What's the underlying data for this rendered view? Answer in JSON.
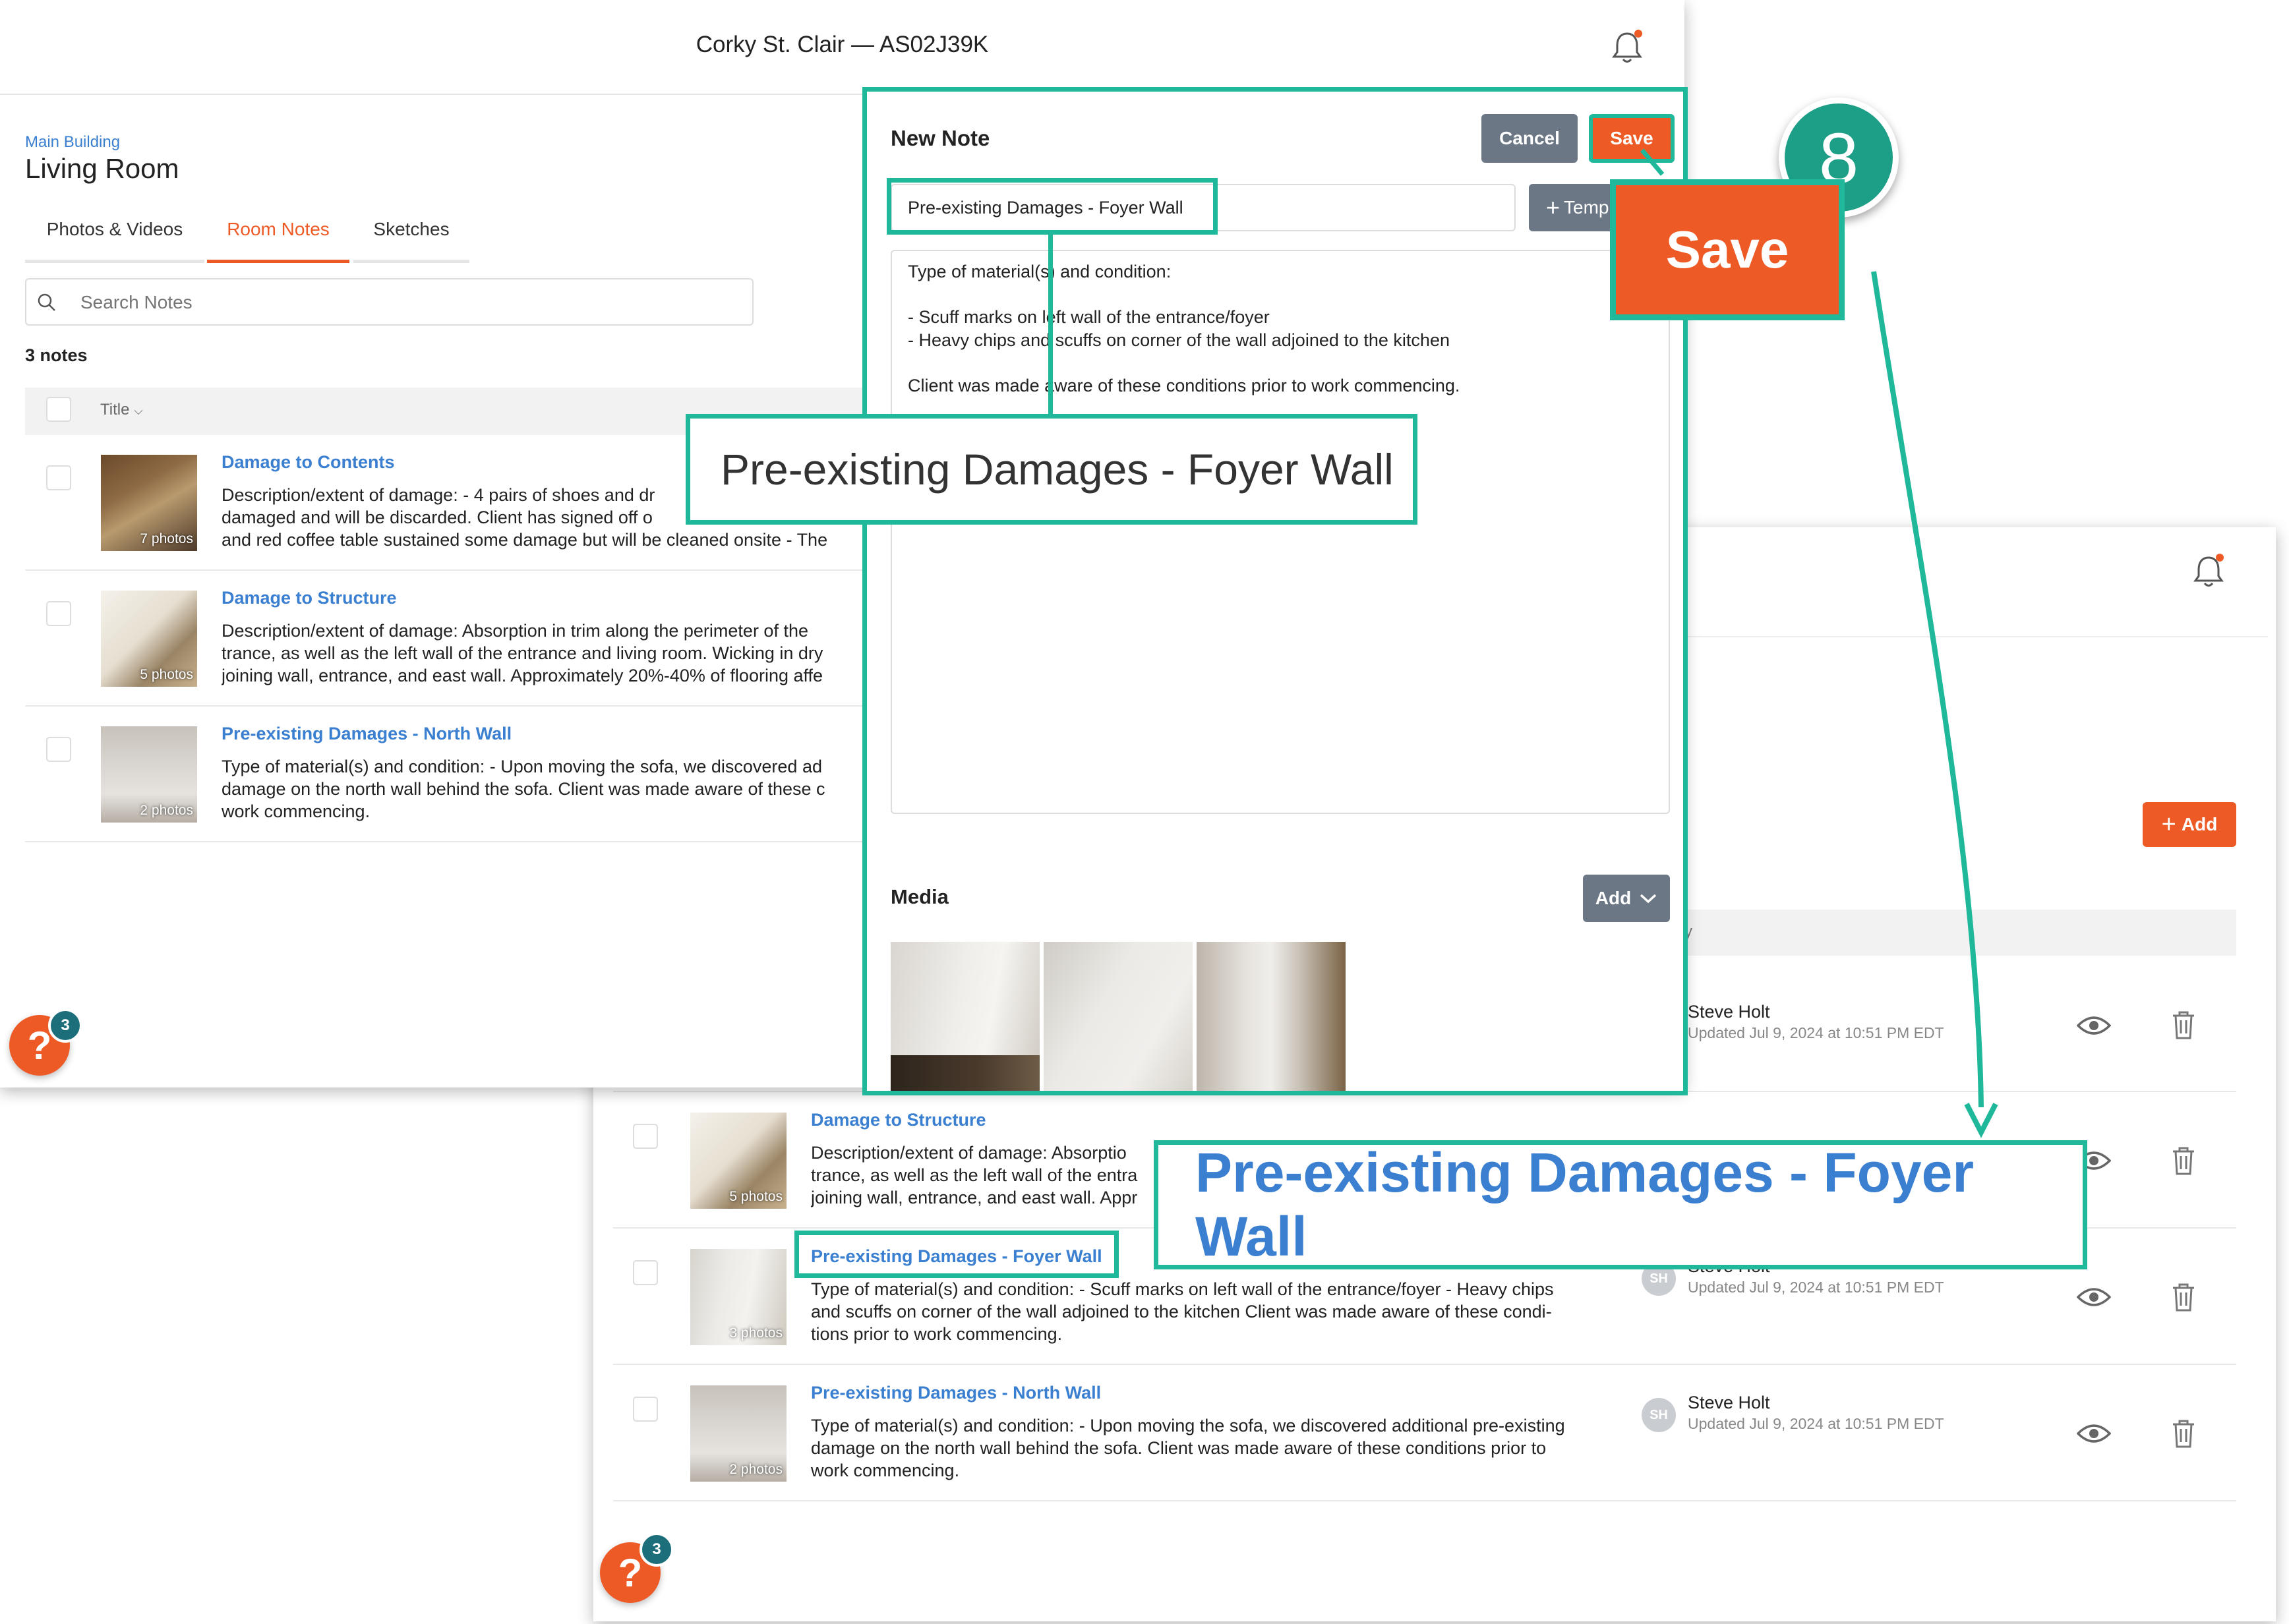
{
  "header": {
    "title": "Corky St. Clair — AS02J39K"
  },
  "room": {
    "breadcrumb": "Main Building",
    "title": "Living Room",
    "tabs": [
      {
        "label": "Photos & Videos"
      },
      {
        "label": "Room Notes"
      },
      {
        "label": "Sketches"
      }
    ],
    "search_placeholder": "Search Notes",
    "notes_count": "3 notes",
    "column_title": "Title",
    "column_by_fragment": "y"
  },
  "back_notes": [
    {
      "title": "Damage to Contents",
      "photos": "7 photos",
      "desc": "Description/extent of damage: - 4 pairs of shoes and dr\ndamaged and will be discarded. Client has signed off o\nand red coffee table sustained some damage but will be cleaned onsite - The"
    },
    {
      "title": "Damage to Structure",
      "photos": "5 photos",
      "desc": "Description/extent of damage: Absorption in trim along the perimeter of the\ntrance, as well as the left wall of the entrance and living room. Wicking in dry\njoining wall, entrance, and east wall. Approximately 20%-40% of flooring affe"
    },
    {
      "title": "Pre-existing Damages - North Wall",
      "photos": "2 photos",
      "desc": "Type of material(s) and condition: - Upon moving the sofa, we discovered ad\ndamage on the north wall behind the sofa. Client was made aware of these c\nwork commencing."
    }
  ],
  "result_notes": [
    {
      "title": "Damage to Structure",
      "photos": "5 photos",
      "desc": "Description/extent of damage: Absorptio\ntrance, as well as the left wall of the entra\njoining wall, entrance, and east wall. Appr",
      "user": "",
      "updated": ""
    },
    {
      "title": "Pre-existing Damages - Foyer Wall",
      "photos": "3 photos",
      "desc": "Type of material(s) and condition: - Scuff marks on left wall of the entrance/foyer - Heavy chips\nand scuffs on corner of the wall adjoined to the kitchen Client was made aware of these condi-\ntions prior to work commencing.",
      "initials": "SH",
      "user": "Steve Holt",
      "updated": "Updated Jul 9, 2024 at 10:51 PM EDT"
    },
    {
      "title": "Pre-existing Damages - North Wall",
      "photos": "2 photos",
      "desc": "Type of material(s) and condition: - Upon moving the sofa, we discovered additional pre-existing\ndamage on the north wall behind the sofa. Client was made aware of these conditions prior to\nwork commencing.",
      "initials": "SH",
      "user": "Steve Holt",
      "updated": "Updated Jul 9, 2024 at 10:51 PM EDT"
    }
  ],
  "first_row": {
    "user": "Steve Holt",
    "updated": "Updated Jul 9, 2024 at 10:51 PM EDT"
  },
  "add_button": "Add",
  "modal": {
    "title": "New Note",
    "cancel": "Cancel",
    "save": "Save",
    "title_value": "Pre-existing Damages - Foyer Wall",
    "template_button": "Temp",
    "body_text": "Type of material(s) and condition:\n\n- Scuff marks on left wall of the entrance/foyer\n- Heavy chips and scuffs on corner of the wall adjoined to the kitchen\n\nClient was made aware of these conditions prior to work commencing.",
    "media_label": "Media",
    "media_add": "Add"
  },
  "callouts": {
    "step_number": "8",
    "save_label": "Save",
    "title_zoom": "Pre-existing Damages - Foyer Wall",
    "result_zoom": "Pre-existing Damages - Foyer Wall"
  },
  "help": {
    "count": "3"
  },
  "colors": {
    "accent": "#ee5a25",
    "teal": "#1fb89a",
    "link": "#3a7fd0",
    "slate": "#6b7785"
  }
}
